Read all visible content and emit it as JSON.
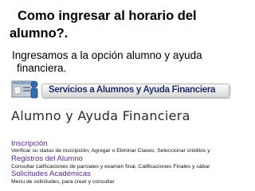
{
  "slide": {
    "title": "Como ingresar al horario del alumno?.",
    "body_line1": "Ingresamos a la opción alumno y ayuda",
    "body_line2": "financiera."
  },
  "portal": {
    "banner_label": "Servicios a Alumnos y Ayuda Financiera",
    "banner_icon": "student-services-icon",
    "heading": "Alumno y Ayuda Financiera",
    "links": [
      {
        "title": "Inscripción",
        "description": "Verificar su status de inscripción; Agregar o Eliminar Clases; Seleccionar créditos y"
      },
      {
        "title": "Registros del Alumno",
        "description": "Consultar calificaciones de parciales y examen final, Calificaciones Finales y sábar"
      },
      {
        "title": "Solicitudes Académicas",
        "description": "Menu de solicitudes, para crear y consultar"
      }
    ]
  },
  "colors": {
    "link": "#5a2a8a",
    "banner_text": "#1f2f66"
  }
}
